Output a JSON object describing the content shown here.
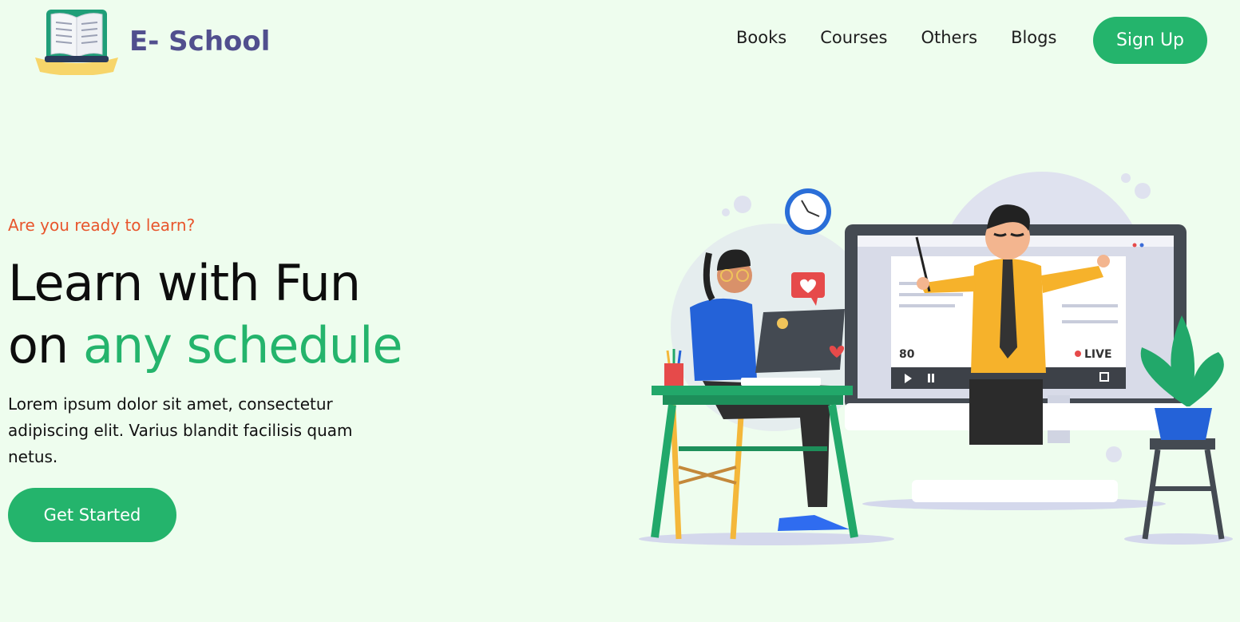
{
  "brand": {
    "name": "E- School",
    "icon": "open-book-icon"
  },
  "nav": {
    "links": [
      "Books",
      "Courses",
      "Others",
      "Blogs"
    ],
    "signup_label": "Sign Up"
  },
  "hero": {
    "tagline": "Are you ready to learn?",
    "headline_line1": "Learn with Fun",
    "headline_line2_prefix": "on ",
    "headline_line2_accent": "any schedule",
    "description": "Lorem ipsum dolor sit amet, consectetur adipiscing elit. Varius blandit facilisis quam netus.",
    "cta_label": "Get Started"
  },
  "illustration": {
    "viewer_count": "80",
    "live_label": "LIVE"
  },
  "colors": {
    "background": "#eefdee",
    "accent": "#24b46c",
    "tagline": "#e8552c",
    "brand_text": "#514f8e"
  }
}
